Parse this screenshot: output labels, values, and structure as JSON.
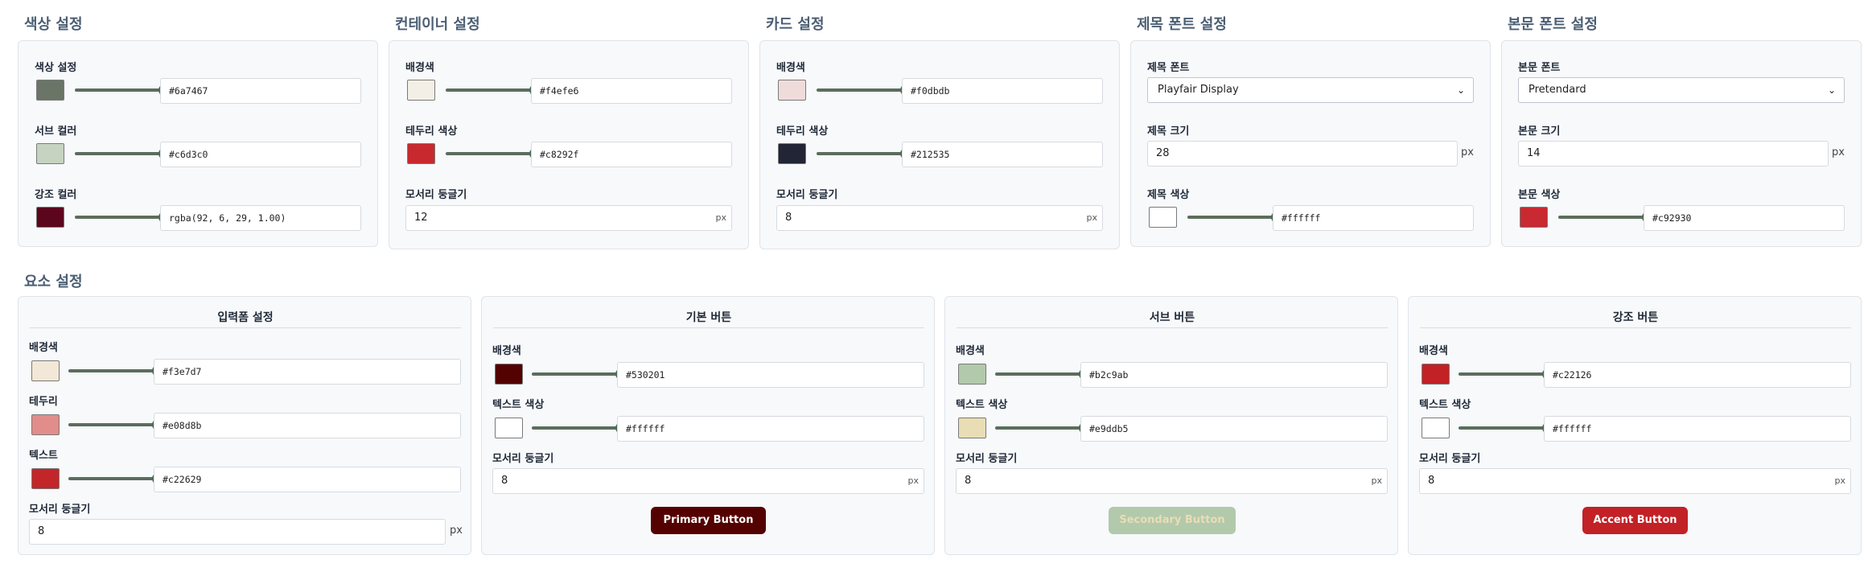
{
  "sections": {
    "color": "색상 설정",
    "container": "컨테이너 설정",
    "card": "카드 설정",
    "title_font": "제목 폰트 설정",
    "body_font": "본문 폰트 설정",
    "elements": "요소 설정"
  },
  "color_settings": {
    "color_label": "색상 설정",
    "color_value": "#6a7467",
    "color_swatch": "#6a7467",
    "sub_label": "서브 컬러",
    "sub_value": "#c6d3c0",
    "sub_swatch": "#c6d3c0",
    "accent_label": "강조 컬러",
    "accent_value": "rgba(92, 6, 29, 1.00)",
    "accent_swatch": "#5c061d"
  },
  "container_settings": {
    "bg_label": "배경색",
    "bg_value": "#f4efe6",
    "bg_swatch": "#f4efe6",
    "border_label": "테두리 색상",
    "border_value": "#c8292f",
    "border_swatch": "#c8292f",
    "radius_label": "모서리 둥글기",
    "radius_value": "12",
    "unit": "px"
  },
  "card_settings": {
    "bg_label": "배경색",
    "bg_value": "#f0dbdb",
    "bg_swatch": "#f0dbdb",
    "border_label": "테두리 색상",
    "border_value": "#212535",
    "border_swatch": "#212535",
    "radius_label": "모서리 둥글기",
    "radius_value": "8",
    "unit": "px"
  },
  "title_font_settings": {
    "font_label": "제목 폰트",
    "font_value": "Playfair Display",
    "size_label": "제목 크기",
    "size_value": "28",
    "unit": "px",
    "color_label": "제목 색상",
    "color_value": "#ffffff",
    "color_swatch": "#ffffff"
  },
  "body_font_settings": {
    "font_label": "본문 폰트",
    "font_value": "Pretendard",
    "size_label": "본문 크기",
    "size_value": "14",
    "unit": "px",
    "color_label": "본문 색상",
    "color_value": "#c92930",
    "color_swatch": "#c92930"
  },
  "input_form": {
    "title": "입력폼 설정",
    "bg_label": "배경색",
    "bg_value": "#f3e7d7",
    "bg_swatch": "#f3e7d7",
    "border_label": "테두리",
    "border_value": "#e08d8b",
    "border_swatch": "#e08d8b",
    "text_label": "텍스트",
    "text_value": "#c22629",
    "text_swatch": "#c22629",
    "radius_label": "모서리 둥글기",
    "radius_value": "8",
    "unit": "px"
  },
  "primary_button": {
    "title": "기본 버튼",
    "bg_label": "배경색",
    "bg_value": "#530201",
    "bg_swatch": "#530201",
    "text_label": "텍스트 색상",
    "text_value": "#ffffff",
    "text_swatch": "#ffffff",
    "radius_label": "모서리 둥글기",
    "radius_value": "8",
    "unit": "px",
    "preview_label": "Primary Button"
  },
  "secondary_button": {
    "title": "서브 버튼",
    "bg_label": "배경색",
    "bg_value": "#b2c9ab",
    "bg_swatch": "#b2c9ab",
    "text_label": "텍스트 색상",
    "text_value": "#e9ddb5",
    "text_swatch": "#e9ddb5",
    "radius_label": "모서리 둥글기",
    "radius_value": "8",
    "unit": "px",
    "preview_label": "Secondary Button"
  },
  "accent_button": {
    "title": "강조 버튼",
    "bg_label": "배경색",
    "bg_value": "#c22126",
    "bg_swatch": "#c22126",
    "text_label": "텍스트 색상",
    "text_value": "#ffffff",
    "text_swatch": "#ffffff",
    "radius_label": "모서리 둥글기",
    "radius_value": "8",
    "unit": "px",
    "preview_label": "Accent Button"
  }
}
